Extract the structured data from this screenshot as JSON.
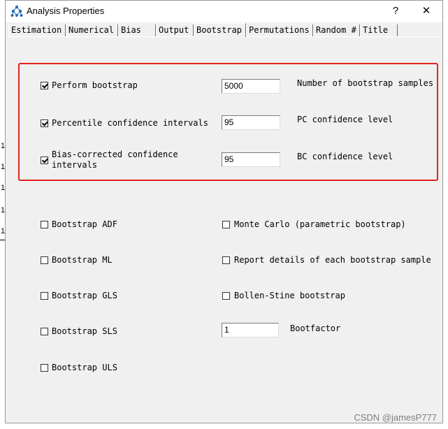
{
  "window": {
    "title": "Analysis Properties",
    "help_label": "?",
    "close_label": "✕"
  },
  "tabs": [
    {
      "label": "Estimation",
      "active": false
    },
    {
      "label": "Numerical",
      "active": false
    },
    {
      "label": "Bias",
      "active": false
    },
    {
      "label": "Output",
      "active": false
    },
    {
      "label": "Bootstrap",
      "active": true
    },
    {
      "label": "Permutations",
      "active": false
    },
    {
      "label": "Random #",
      "active": false
    },
    {
      "label": "Title",
      "active": false
    }
  ],
  "bootstrap": {
    "perform": {
      "label": "Perform bootstrap",
      "checked": true,
      "value": "5000",
      "value_label": "Number of bootstrap samples"
    },
    "percentile": {
      "label": "Percentile confidence intervals",
      "checked": true,
      "value": "95",
      "value_label": "PC confidence level"
    },
    "bias_corrected": {
      "label": "Bias-corrected confidence intervals",
      "checked": true,
      "value": "95",
      "value_label": "BC confidence level"
    },
    "left_options": [
      {
        "label": "Bootstrap ADF",
        "checked": false
      },
      {
        "label": "Bootstrap ML",
        "checked": false
      },
      {
        "label": "Bootstrap GLS",
        "checked": false
      },
      {
        "label": "Bootstrap SLS",
        "checked": false
      },
      {
        "label": "Bootstrap ULS",
        "checked": false
      }
    ],
    "right_options": [
      {
        "label": "Monte Carlo (parametric bootstrap)",
        "checked": false
      },
      {
        "label": "Report details of each bootstrap sample",
        "checked": false
      },
      {
        "label": "Bollen-Stine bootstrap",
        "checked": false
      }
    ],
    "bootfactor": {
      "label": "Bootfactor",
      "value": "1"
    }
  },
  "watermark": "CSDN @jamesP777",
  "highlight_color": "#e2231a"
}
